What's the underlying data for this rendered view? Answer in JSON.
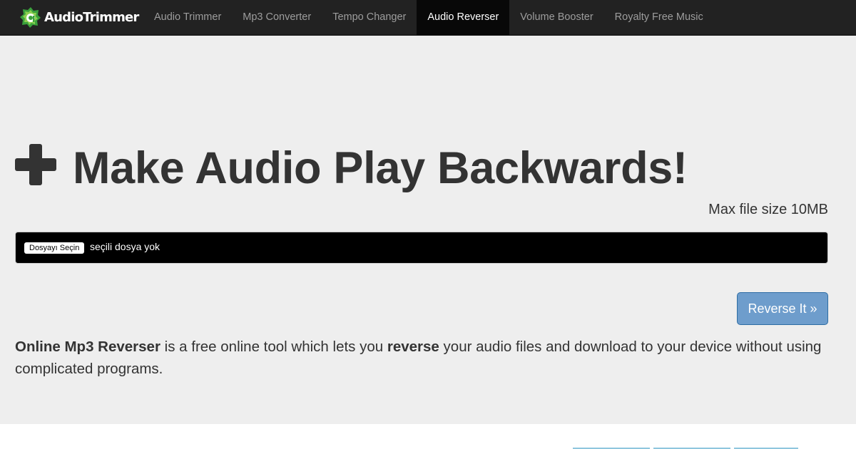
{
  "brand": {
    "name": "AudioTrimmer",
    "colors": {
      "logo_green": "#3aa13c",
      "logo_light": "#8ccf4f"
    }
  },
  "nav": {
    "items": [
      {
        "label": "Audio Trimmer",
        "active": false
      },
      {
        "label": "Mp3 Converter",
        "active": false
      },
      {
        "label": "Tempo Changer",
        "active": false
      },
      {
        "label": "Audio Reverser",
        "active": true
      },
      {
        "label": "Volume Booster",
        "active": false
      },
      {
        "label": "Royalty Free Music",
        "active": false
      }
    ]
  },
  "main": {
    "headline": "Make Audio Play Backwards!",
    "headline_icon": "plus-icon",
    "max_file_size": "Max file size 10MB",
    "file_input": {
      "button_label": "Dosyayı Seçin",
      "status_text": "seçili dosya yok"
    },
    "submit_label": "Reverse It »",
    "description": {
      "part1_bold": "Online Mp3 Reverser",
      "part2": " is a free online tool which lets you ",
      "part3_bold": "reverse",
      "part4": " your audio files and download to your device without using complicated programs."
    }
  },
  "colors": {
    "navbar_bg": "#222222",
    "nav_active_bg": "#080808",
    "jumbotron_bg": "#eeeeee",
    "primary_button": "#6e9dcc"
  }
}
